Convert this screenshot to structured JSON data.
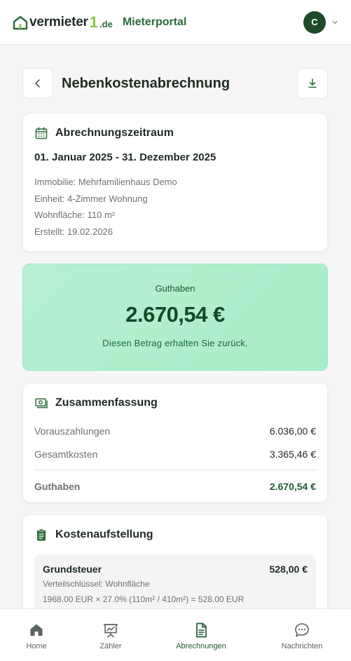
{
  "header": {
    "logo_text": "vermieter",
    "logo_one": "1",
    "logo_tld": ".de",
    "portal_title": "Mieterportal",
    "avatar_initial": "C"
  },
  "page": {
    "title": "Nebenkostenabrechnung"
  },
  "period_card": {
    "title": "Abrechnungszeitraum",
    "range": "01. Januar 2025 - 31. Dezember 2025",
    "lines": [
      "Immobilie: Mehrfamilienhaus Demo",
      "Einheit: 4-Zimmer Wohnung",
      "Wohnfläche: 110 m²",
      "Erstellt: 19.02.2026"
    ]
  },
  "credit_card": {
    "label": "Guthaben",
    "amount": "2.670,54 €",
    "note": "Diesen Betrag erhalten Sie zurück."
  },
  "summary": {
    "title": "Zusammenfassung",
    "rows": [
      {
        "label": "Vorauszahlungen",
        "value": "6.036,00 €"
      },
      {
        "label": "Gesamtkosten",
        "value": "3.365,46 €"
      }
    ],
    "total": {
      "label": "Guthaben",
      "value": "2.670,54 €"
    }
  },
  "costs": {
    "title": "Kostenaufstellung",
    "items": [
      {
        "name": "Grundsteuer",
        "amount": "528,00 €",
        "key": "Verteilschlüssel: Wohnfläche",
        "formula": "1968.00 EUR × 27.0% (110m² / 410m²) = 528.00 EUR"
      }
    ]
  },
  "bottom_nav": {
    "items": [
      {
        "label": "Home",
        "icon": "home-icon",
        "active": false
      },
      {
        "label": "Zähler",
        "icon": "meter-icon",
        "active": false
      },
      {
        "label": "Abrechnungen",
        "icon": "document-icon",
        "active": true
      },
      {
        "label": "Nachrichten",
        "icon": "chat-icon",
        "active": false
      }
    ]
  },
  "colors": {
    "brand_dark": "#1f4a2a",
    "brand_green": "#2a6b3a",
    "accent_lime": "#8cc63f",
    "credit_bg": "#b9efd3"
  }
}
